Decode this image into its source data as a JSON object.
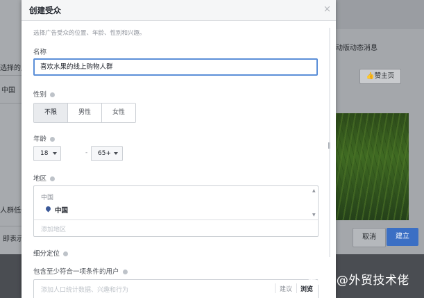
{
  "background": {
    "left_labels": [
      "选择的用户",
      "中国",
      "人群低于",
      "即表示"
    ],
    "right_header": "动版动态消息",
    "like_button": "赞主页",
    "cancel_button": "取消",
    "create_button": "建立",
    "watermark": "知乎 @外贸技术佬"
  },
  "modal": {
    "title": "创建受众",
    "close_symbol": "×",
    "hint": "选择广告受众的位置、年龄、性别和兴趣。",
    "name": {
      "label": "名称",
      "value": "喜欢水果的线上购物人群"
    },
    "gender": {
      "label": "性别",
      "options": [
        "不限",
        "男性",
        "女性"
      ],
      "selected": "不限"
    },
    "age": {
      "label": "年龄",
      "min": "18",
      "max": "65+",
      "separator": "-"
    },
    "region": {
      "label": "地区",
      "list_header": "中国",
      "items": [
        "中国"
      ],
      "add_placeholder": "添加地区"
    },
    "detailed_targeting": {
      "label": "细分定位",
      "include_label": "包含至少符合一项条件的用户",
      "input_placeholder": "添加人口统计数据、兴趣和行为",
      "suggestions": "建议",
      "browse": "浏览"
    }
  },
  "icons": [
    "close-icon",
    "info-icon",
    "caret-down-icon",
    "map-pin-icon",
    "thumbs-up-icon",
    "scrollbar"
  ]
}
